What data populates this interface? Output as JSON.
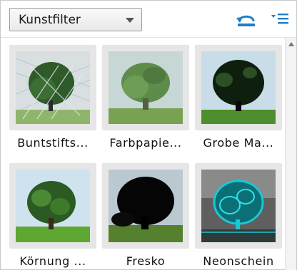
{
  "toolbar": {
    "category_select": "Kunstfilter",
    "reset_icon": "reset-rotate-icon",
    "menu_icon": "panel-menu-icon"
  },
  "filters": [
    {
      "label": "Buntstifts...",
      "style": "colored-pencil"
    },
    {
      "label": "Farbpapie...",
      "style": "cutout"
    },
    {
      "label": "Grobe Ma...",
      "style": "dry-brush"
    },
    {
      "label": "Körnung ...",
      "style": "film-grain"
    },
    {
      "label": "Fresko",
      "style": "fresco"
    },
    {
      "label": "Neonschein",
      "style": "neon-glow"
    }
  ],
  "colors": {
    "neon": "#19c8d2",
    "neon_bg": "#5f5f5f",
    "sky": "#cfe3ef",
    "grass": "#6cab3a",
    "tree_dark": "#22401d"
  }
}
